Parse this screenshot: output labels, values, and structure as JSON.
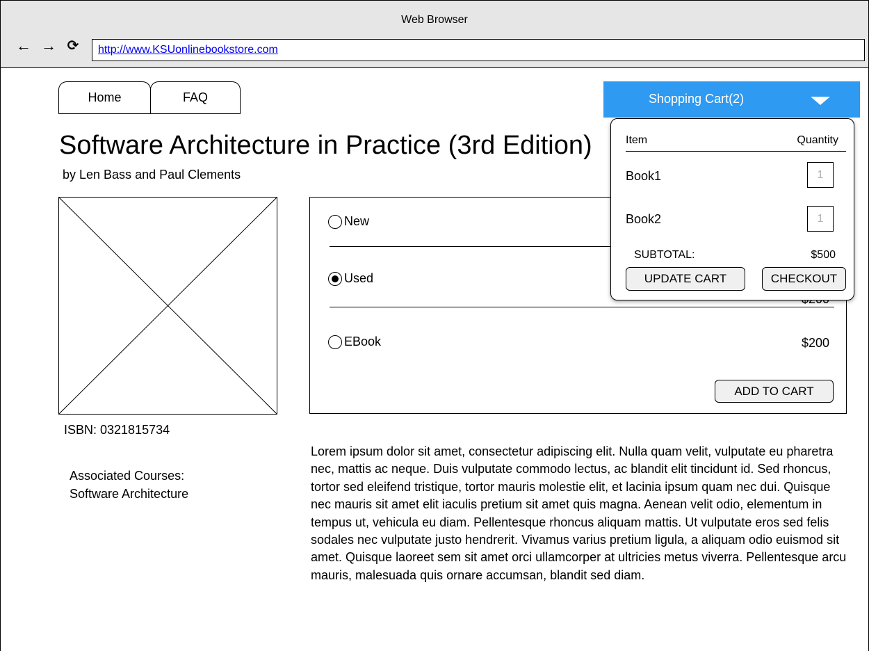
{
  "browser": {
    "window_title": "Web Browser",
    "back_glyph": "←",
    "forward_glyph": "→",
    "reload_glyph": "⟳",
    "url": "http://www.KSUonlinebookstore.com"
  },
  "nav": {
    "tabs": [
      {
        "label": "Home"
      },
      {
        "label": "FAQ"
      }
    ]
  },
  "cart": {
    "label": "Shopping Cart(2)",
    "accent_color": "#2e9af1",
    "dropdown": {
      "item_header": "Item",
      "quantity_header": "Quantity",
      "items": [
        {
          "name": "Book1",
          "quantity": "1"
        },
        {
          "name": "Book2",
          "quantity": "1"
        }
      ],
      "subtotal_label": "SUBTOTAL:",
      "subtotal_value": "$500",
      "update_label": "UPDATE CART",
      "checkout_label": "CHECKOUT"
    }
  },
  "book": {
    "title": "Software Architecture in Practice (3rd Edition)",
    "author": "by Len Bass and Paul Clements",
    "isbn": "ISBN: 0321815734",
    "courses_label": "Associated Courses:",
    "courses_value": "Software Architecture",
    "description": "Lorem ipsum dolor sit amet, consectetur adipiscing elit. Nulla quam velit, vulputate eu pharetra nec, mattis ac neque. Duis vulputate commodo lectus, ac blandit elit tincidunt id. Sed rhoncus, tortor sed eleifend tristique, tortor mauris molestie elit, et lacinia ipsum quam nec dui. Quisque nec mauris sit amet elit iaculis pretium sit amet quis magna. Aenean velit odio, elementum in tempus ut, vehicula eu diam. Pellentesque rhoncus aliquam mattis. Ut vulputate eros sed felis sodales nec vulputate justo hendrerit. Vivamus varius pretium ligula, a aliquam odio euismod sit amet. Quisque laoreet sem sit amet orci ullamcorper at ultricies metus viverra. Pellentesque arcu mauris, malesuada quis ornare accumsan, blandit sed diam."
  },
  "purchase": {
    "options": [
      {
        "label": "New",
        "selected": false
      },
      {
        "label": "Used",
        "selected": true
      },
      {
        "label": "EBook",
        "selected": false,
        "price": "$200"
      }
    ],
    "used_price_partial": "$200",
    "add_to_cart_label": "ADD TO CART"
  }
}
